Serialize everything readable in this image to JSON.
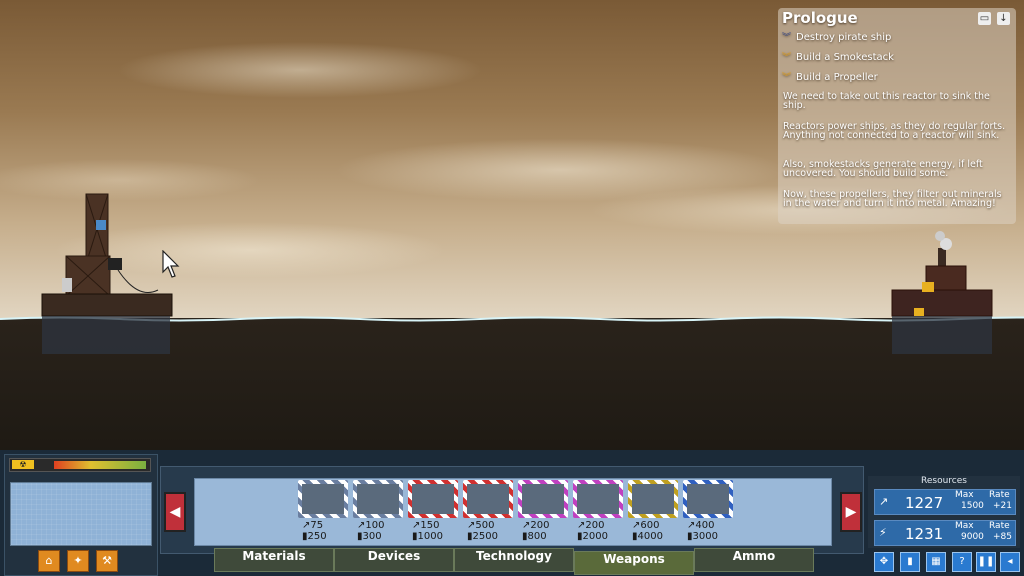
{
  "objectives": {
    "title": "Prologue",
    "tasks": [
      {
        "label": "Destroy pirate ship",
        "marker_color": "#3a4a8a"
      },
      {
        "label": "Build a Smokestack",
        "marker_color": "#e0a020"
      },
      {
        "label": "Build a Propeller",
        "marker_color": "#e0a020"
      }
    ],
    "paragraphs": [
      "We need to take out this reactor to sink the ship.",
      "Reactors power ships, as they do regular forts. Anything not connected to a reactor will sink.",
      "Also, smokestacks generate energy, if left uncovered. You should build some.",
      "Now, these propellers, they filter out minerals in the water and turn it into metal. Amazing!"
    ]
  },
  "power_bar": {
    "icon": "radiation-icon",
    "level": 0.95
  },
  "weapons": [
    {
      "metal": "75",
      "energy": "250",
      "border": "#6a7ea0"
    },
    {
      "metal": "100",
      "energy": "300",
      "border": "#6a7ea0"
    },
    {
      "metal": "150",
      "energy": "1000",
      "border": "#d03030"
    },
    {
      "metal": "500",
      "energy": "2500",
      "border": "#d03030"
    },
    {
      "metal": "200",
      "energy": "800",
      "border": "#c040c0"
    },
    {
      "metal": "200",
      "energy": "2000",
      "border": "#c040c0"
    },
    {
      "metal": "600",
      "energy": "4000",
      "border": "#c0a020"
    },
    {
      "metal": "400",
      "energy": "3000",
      "border": "#3060c0"
    }
  ],
  "tabs": {
    "materials": "Materials",
    "devices": "Devices",
    "technology": "Technology",
    "weapons": "Weapons",
    "ammo": "Ammo",
    "selected": "Weapons"
  },
  "resources": {
    "title": "Resources",
    "metal": {
      "value": "1227",
      "max_label": "Max",
      "max": "1500",
      "rate_label": "Rate",
      "rate": "+21"
    },
    "energy": {
      "value": "1231",
      "max_label": "Max",
      "max": "9000",
      "rate_label": "Rate",
      "rate": "+85"
    }
  },
  "colors": {
    "accent": "#2a7ad0",
    "arrow": "#c0303a",
    "sea": "#1e1a14"
  }
}
